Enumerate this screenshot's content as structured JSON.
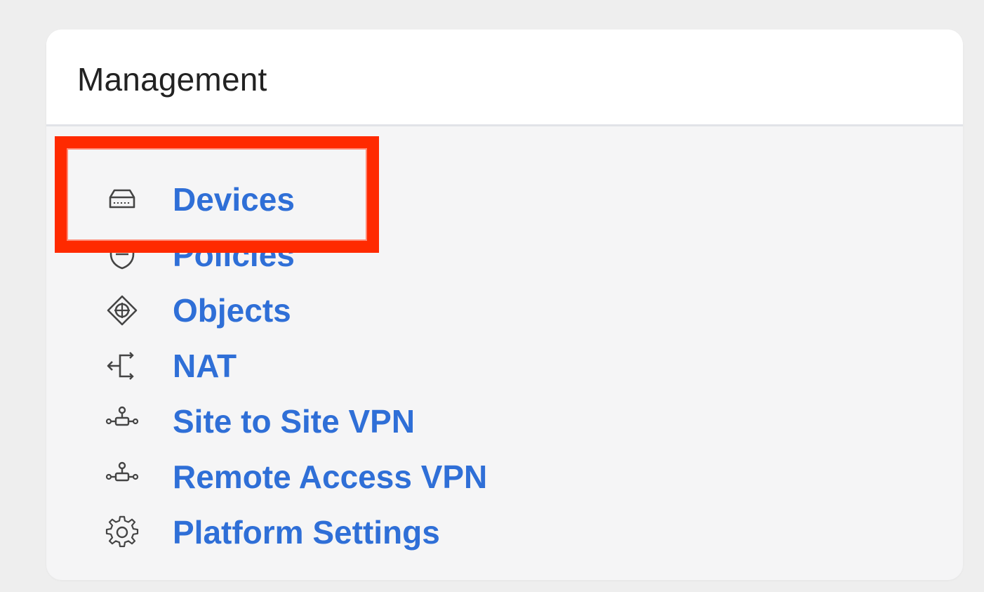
{
  "card": {
    "title": "Management"
  },
  "menu": {
    "items": [
      {
        "label": "Devices",
        "icon": "device-icon"
      },
      {
        "label": "Policies",
        "icon": "shield-icon"
      },
      {
        "label": "Objects",
        "icon": "objects-icon"
      },
      {
        "label": "NAT",
        "icon": "nat-icon"
      },
      {
        "label": "Site to Site VPN",
        "icon": "vpn-network-icon"
      },
      {
        "label": "Remote Access VPN",
        "icon": "vpn-network-icon"
      },
      {
        "label": "Platform Settings",
        "icon": "gear-icon"
      }
    ]
  },
  "colors": {
    "link": "#2f6fd7",
    "highlight": "#ff2a00",
    "card_background": "#f5f5f6",
    "header_background": "#ffffff"
  }
}
